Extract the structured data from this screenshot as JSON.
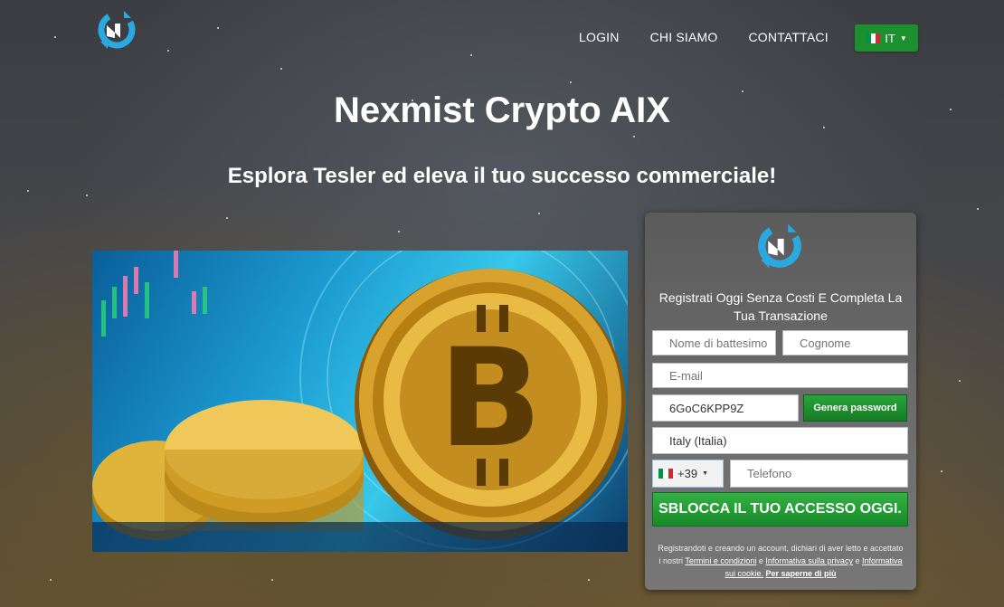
{
  "header": {
    "nav": [
      "LOGIN",
      "CHI SIAMO",
      "CONTATTACI"
    ],
    "language": "IT"
  },
  "hero": {
    "title": "Nexmist Crypto AIX",
    "subtitle": "Esplora Tesler ed eleva il tuo successo commerciale!"
  },
  "form": {
    "heading": "Registrati Oggi Senza Costi E Completa La Tua Transazione",
    "first_name_placeholder": "Nome di battesimo",
    "last_name_placeholder": "Cognome",
    "email_placeholder": "E-mail",
    "password_value": "6GoC6KPP9Z",
    "generate_label": "Genera password",
    "country_value": "Italy (Italia)",
    "phone_prefix": "+39",
    "phone_placeholder": "Telefono",
    "submit_label": "SBLOCCA IL TUO ACCESSO OGGI.",
    "disclaimer": {
      "part1": "Registrandoti e creando un account, dichiari di aver letto e accettato i nostri",
      "terms": "Termini e condizioni",
      "and": "e",
      "privacy": "Informativa sulla privacy",
      "and2": "e",
      "cookie": "Informativa sui cookie.",
      "more": "Per saperne di più"
    }
  },
  "colors": {
    "accent_green": "#1c8f2e",
    "logo_blue": "#29a9e0"
  }
}
